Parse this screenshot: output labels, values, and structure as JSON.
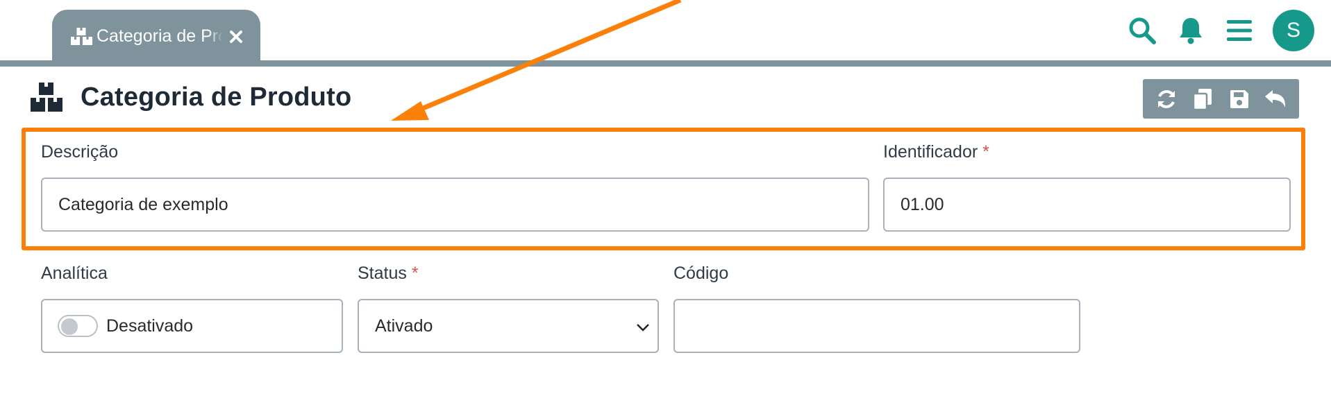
{
  "tab": {
    "label": "Categoria de Produto"
  },
  "topbar": {
    "avatar_initial": "S"
  },
  "header": {
    "title": "Categoria de Produto"
  },
  "toolbar": {
    "buttons": [
      "refresh-icon",
      "copy-icon",
      "save-icon",
      "undo-icon"
    ]
  },
  "form": {
    "descricao": {
      "label": "Descrição",
      "value": "Categoria de exemplo"
    },
    "identificador": {
      "label": "Identificador",
      "required_mark": "*",
      "value": "01.00"
    },
    "analitica": {
      "label": "Analítica",
      "toggle_text": "Desativado",
      "enabled": false
    },
    "status": {
      "label": "Status",
      "required_mark": "*",
      "selected": "Ativado"
    },
    "codigo": {
      "label": "Código",
      "value": ""
    }
  },
  "colors": {
    "accent": "#16998a",
    "tab_bar": "#7e939b",
    "highlight": "#fb8009",
    "required": "#d9534f"
  }
}
